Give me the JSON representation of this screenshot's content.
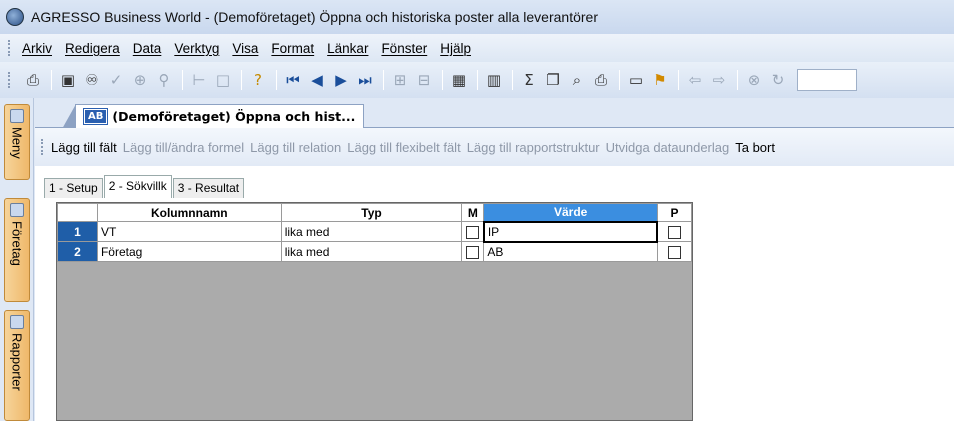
{
  "window": {
    "title": "AGRESSO Business World - (Demoföretaget) Öppna och historiska poster alla leverantörer"
  },
  "menu": [
    "Arkiv",
    "Redigera",
    "Data",
    "Verktyg",
    "Visa",
    "Format",
    "Länkar",
    "Fönster",
    "Hjälp"
  ],
  "toolbar_icons": [
    "print-icon",
    "save-icon",
    "binoculars-icon",
    "check-icon",
    "zoom-icon",
    "filter-icon",
    "tree-icon",
    "box-icon",
    "help-icon",
    "first-icon",
    "prev-icon",
    "next-icon",
    "last-icon",
    "columns-icon",
    "rows-icon",
    "table-icon",
    "chart-icon",
    "sum-icon",
    "copy-icon",
    "search-icon",
    "printer2-icon",
    "window-icon",
    "flag-icon",
    "back-icon",
    "forward-icon",
    "stop-icon",
    "refresh-icon"
  ],
  "sidebar": {
    "tabs": [
      "Meny",
      "Företag",
      "Rapporter"
    ]
  },
  "document_tab": {
    "badge": "AB",
    "label": "(Demoföretaget) Öppna och hist..."
  },
  "actions": [
    {
      "label": "Lägg till fält",
      "enabled": true
    },
    {
      "label": "Lägg till/ändra formel",
      "enabled": false
    },
    {
      "label": "Lägg till relation",
      "enabled": false
    },
    {
      "label": "Lägg till flexibelt fält",
      "enabled": false
    },
    {
      "label": "Lägg till rapportstruktur",
      "enabled": false
    },
    {
      "label": "Utvidga dataunderlag",
      "enabled": false
    },
    {
      "label": "Ta bort",
      "enabled": true
    }
  ],
  "subtabs": [
    "1 - Setup",
    "2 - Sökvillk",
    "3 - Resultat"
  ],
  "grid": {
    "headers": [
      "Kolumnnamn",
      "Typ",
      "M",
      "Värde",
      "P"
    ],
    "rows": [
      {
        "num": "1",
        "kolumnnamn": "VT",
        "typ": "lika med",
        "varde": "IP"
      },
      {
        "num": "2",
        "kolumnnamn": "Företag",
        "typ": "lika med",
        "varde": "AB"
      }
    ]
  }
}
